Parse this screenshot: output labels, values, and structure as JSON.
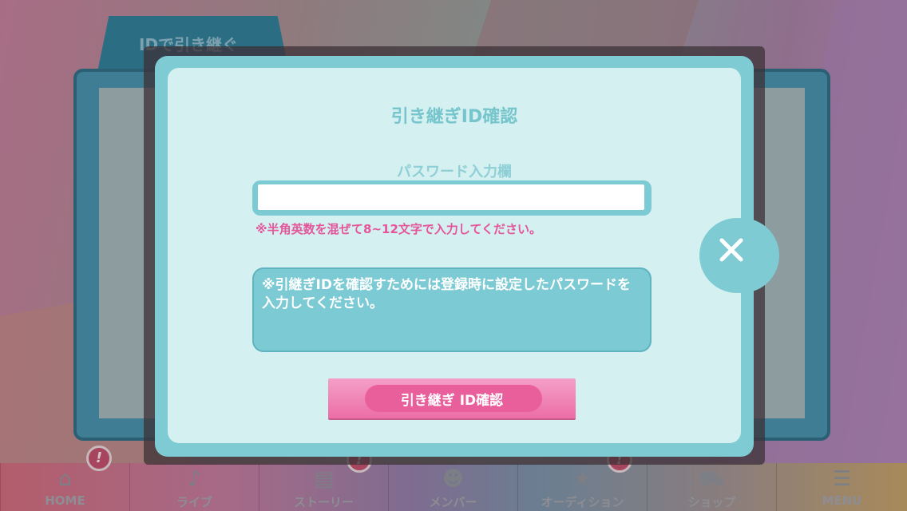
{
  "background": {
    "tab_label": "IDで引き継ぐ"
  },
  "nav": {
    "items": [
      {
        "label": "HOME",
        "icon": "home-icon",
        "glyph": "⌂"
      },
      {
        "label": "ライブ",
        "icon": "music-note-icon",
        "glyph": "♪"
      },
      {
        "label": "ストーリー",
        "icon": "book-icon",
        "glyph": "▤"
      },
      {
        "label": "メンバー",
        "icon": "member-icon",
        "glyph": "☻"
      },
      {
        "label": "オーディション",
        "icon": "audition-star-icon",
        "glyph": "★"
      },
      {
        "label": "ショップ",
        "icon": "shop-basket-icon",
        "glyph": "⛟"
      },
      {
        "label": "MENU",
        "icon": "menu-list-icon",
        "glyph": "☰"
      }
    ],
    "alert_glyph": "!"
  },
  "dialog": {
    "title": "引き継ぎID確認",
    "password_label": "パスワード入力欄",
    "password_value": "",
    "password_note": "※半角英数を混ぜて8~12文字で入力してください。",
    "info_text": "※引継ぎIDを確認すためには登録時に設定したパスワードを入力してください。",
    "confirm_label": "引き継ぎ ID確認"
  },
  "colors": {
    "dialog_accent": "#7fcbd4",
    "note_pink": "#e4559a",
    "button_pink": "#ec6ea6"
  }
}
